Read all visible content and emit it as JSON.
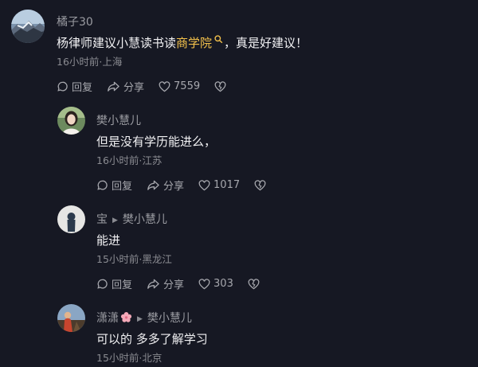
{
  "top": {
    "user": "橘子30",
    "text_before": "杨律师建议小慧读书读",
    "link": "商学院",
    "text_after": "，真是好建议！",
    "meta": "16小时前·上海",
    "reply_label": "回复",
    "share_label": "分享",
    "like_count": "7559"
  },
  "replies": [
    {
      "user": "樊小慧儿",
      "text": "但是没有学历能进么，",
      "meta": "16小时前·江苏",
      "reply_label": "回复",
      "share_label": "分享",
      "like_count": "1017"
    },
    {
      "user": "宝",
      "reply_to": "樊小慧儿",
      "text": "能进",
      "meta": "15小时前·黑龙江",
      "reply_label": "回复",
      "share_label": "分享",
      "like_count": "303"
    },
    {
      "user": "潇潇",
      "reply_to": "樊小慧儿",
      "text": "可以的 多多了解学习",
      "meta": "15小时前·北京"
    }
  ],
  "colors": {
    "background": "#161823",
    "link": "#f3c14b"
  }
}
